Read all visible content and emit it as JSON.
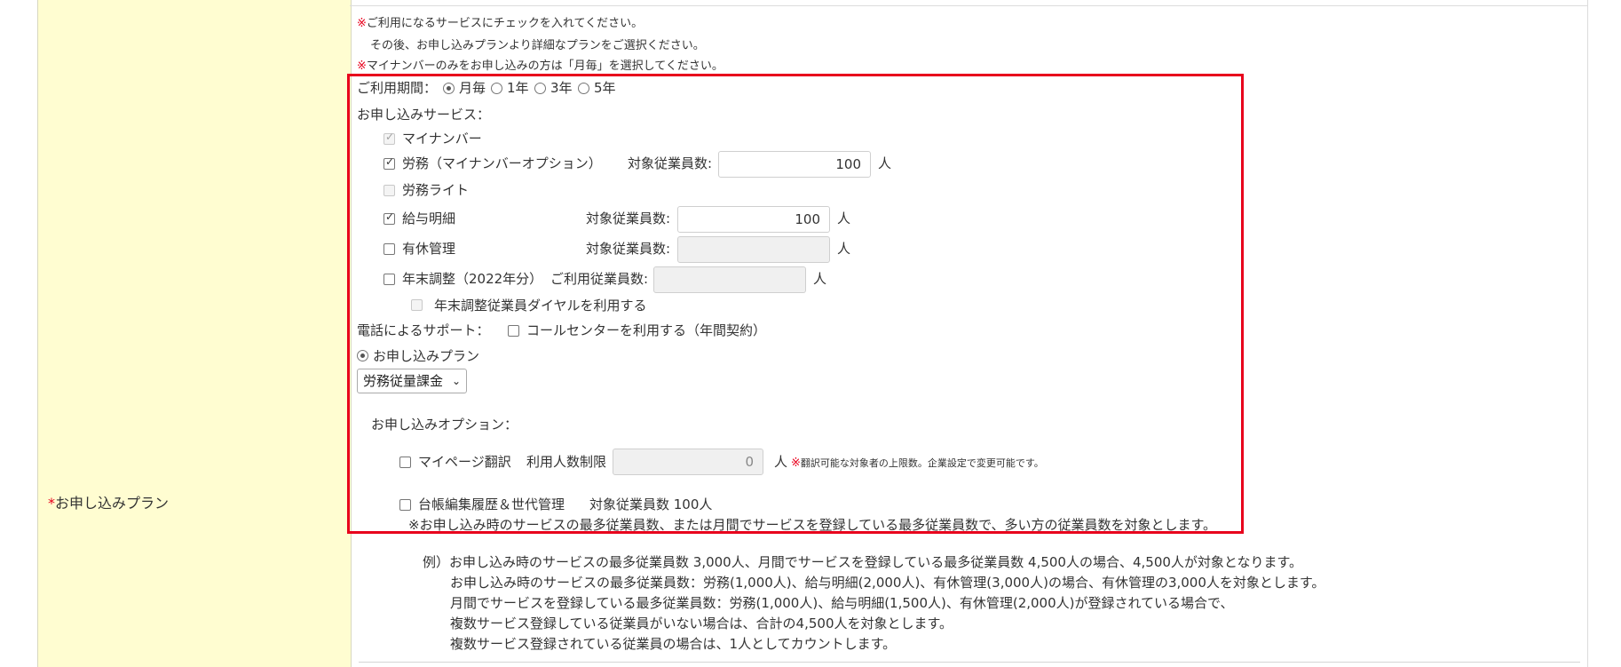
{
  "field_label": "お申し込みプラン",
  "required_mark": "*",
  "notes": {
    "line1_mark": "※",
    "line1": "ご利用になるサービスにチェックを入れてください。",
    "line2": "その後、お申し込みプランより詳細なプランをご選択ください。",
    "line3_mark": "※",
    "line3": "マイナンバーのみをお申し込みの方は「月毎」を選択してください。"
  },
  "period": {
    "label": "ご利用期間：",
    "options": [
      "月毎",
      "1年",
      "3年",
      "5年"
    ],
    "selected": "月毎"
  },
  "services": {
    "label": "お申し込みサービス：",
    "mynumber": "マイナンバー",
    "labor": "労務（マイナンバーオプション）",
    "labor_count_label": "対象従業員数:",
    "labor_count": "100",
    "labor_lite": "労務ライト",
    "payslip": "給与明細",
    "payslip_count_label": "対象従業員数:",
    "payslip_count": "100",
    "leave": "有休管理",
    "leave_count_label": "対象従業員数:",
    "leave_count": "",
    "yearend": "年末調整（2022年分）",
    "yearend_count_label": "ご利用従業員数:",
    "yearend_count": "",
    "yearend_dial": "年末調整従業員ダイヤルを利用する",
    "unit": "人"
  },
  "phone_support": {
    "label": "電話によるサポート：",
    "option": "コールセンターを利用する（年間契約）"
  },
  "plan": {
    "radio_label": "お申し込みプラン",
    "selected": "労務従量課金",
    "chevron": "⌄"
  },
  "options": {
    "label": "お申し込みオプション：",
    "mypage": "マイページ翻訳",
    "mypage_limit_label": "利用人数制限",
    "mypage_limit": "0",
    "unit": "人",
    "mypage_note_mark": "※",
    "mypage_note": "翻訳可能な対象者の上限数。企業設定で変更可能です。",
    "ledger": "台帳編集履歴＆世代管理",
    "ledger_count": "対象従業員数 100人",
    "ledger_note": "※お申し込み時のサービスの最多従業員数、または月間でサービスを登録している最多従業員数で、多い方の従業員数を対象とします。"
  },
  "example": {
    "lines": [
      "例）お申し込み時のサービスの最多従業員数 3,000人、月間でサービスを登録している最多従業員数 4,500人の場合、4,500人が対象となります。",
      "お申し込み時のサービスの最多従業員数：労務(1,000人)、給与明細(2,000人)、有休管理(3,000人)の場合、有休管理の3,000人を対象とします。",
      "月間でサービスを登録している最多従業員数：労務(1,000人)、給与明細(1,500人)、有休管理(2,000人)が登録されている場合で、",
      "複数サービス登録している従業員がいない場合は、合計の4,500人を対象とします。",
      "複数サービス登録されている従業員の場合は、1人としてカウントします。"
    ]
  },
  "colors": {
    "highlight_border": "#e8001c",
    "label_background": "#fffdd1",
    "required": "#e8001c"
  }
}
